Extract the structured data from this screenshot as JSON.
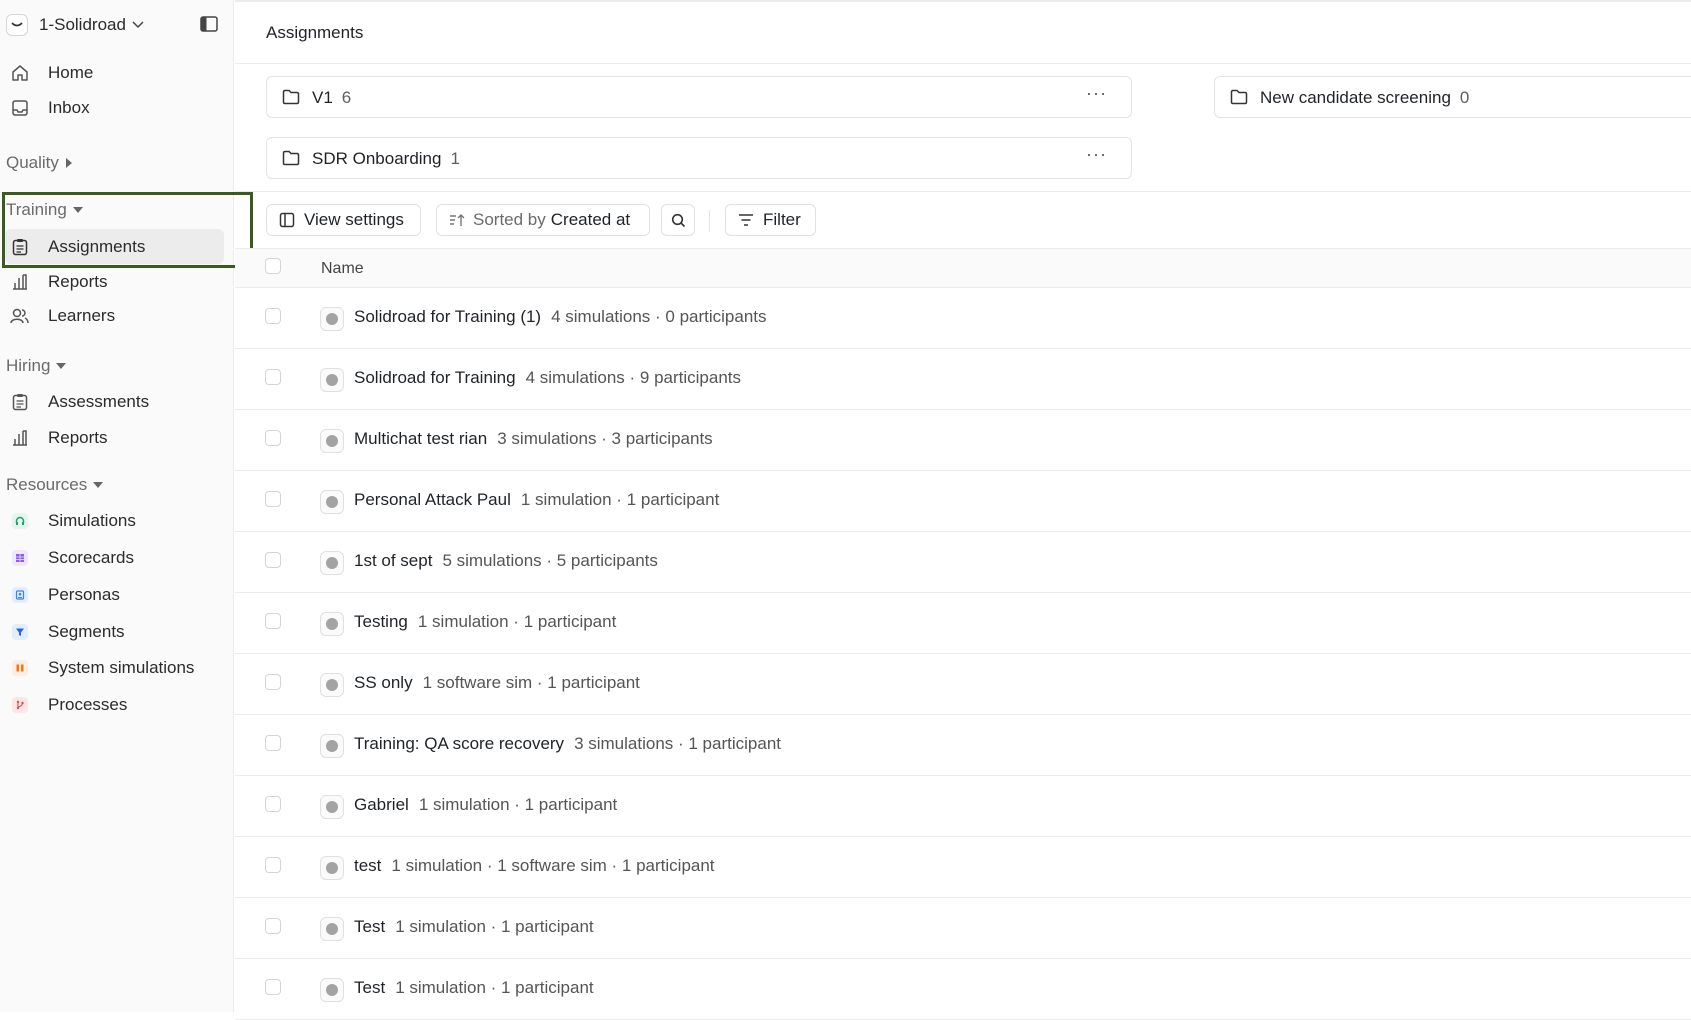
{
  "workspace": {
    "name": "1-Solidroad"
  },
  "nav": {
    "home": "Home",
    "inbox": "Inbox",
    "quality": "Quality",
    "training": {
      "label": "Training",
      "items": [
        {
          "label": "Assignments",
          "icon": "clipboard-icon",
          "active": true
        },
        {
          "label": "Reports",
          "icon": "bar-chart-icon"
        },
        {
          "label": "Learners",
          "icon": "users-icon"
        }
      ]
    },
    "hiring": {
      "label": "Hiring",
      "items": [
        {
          "label": "Assessments",
          "icon": "clipboard-icon"
        },
        {
          "label": "Reports",
          "icon": "bar-chart-icon"
        }
      ]
    },
    "resources": {
      "label": "Resources",
      "items": [
        {
          "label": "Simulations",
          "icon": "headset-icon",
          "color": "#22a06b"
        },
        {
          "label": "Scorecards",
          "icon": "grid-icon",
          "color": "#8b5cf6"
        },
        {
          "label": "Personas",
          "icon": "id-card-icon",
          "color": "#3b82f6"
        },
        {
          "label": "Segments",
          "icon": "funnel-icon",
          "color": "#2563eb"
        },
        {
          "label": "System simulations",
          "icon": "columns-icon",
          "color": "#f97316"
        },
        {
          "label": "Processes",
          "icon": "branch-icon",
          "color": "#ef4444"
        }
      ]
    }
  },
  "page": {
    "title": "Assignments"
  },
  "folders": [
    {
      "name": "V1",
      "count": "6",
      "more": "···"
    },
    {
      "name": "New candidate screening",
      "count": "0"
    },
    {
      "name": "SDR Onboarding",
      "count": "1",
      "more": "···"
    }
  ],
  "toolbar": {
    "view_settings": "View settings",
    "sorted_by_prefix": "Sorted by",
    "sorted_by_value": "Created at",
    "filter": "Filter"
  },
  "table": {
    "column_name": "Name",
    "rows": [
      {
        "name": "Solidroad for Training (1)",
        "meta": "4 simulations · 0 participants"
      },
      {
        "name": "Solidroad for Training",
        "meta": "4 simulations · 9 participants"
      },
      {
        "name": "Multichat test rian",
        "meta": "3 simulations · 3 participants"
      },
      {
        "name": "Personal Attack Paul",
        "meta": "1 simulation · 1 participant"
      },
      {
        "name": "1st of sept",
        "meta": "5 simulations · 5 participants"
      },
      {
        "name": "Testing",
        "meta": "1 simulation · 1 participant"
      },
      {
        "name": "SS only",
        "meta": "1 software sim · 1 participant"
      },
      {
        "name": "Training: QA score recovery",
        "meta": "3 simulations · 1 participant"
      },
      {
        "name": "Gabriel",
        "meta": "1 simulation · 1 participant"
      },
      {
        "name": "test",
        "meta": "1 simulation · 1 software sim · 1 participant"
      },
      {
        "name": "Test",
        "meta": "1 simulation · 1 participant"
      },
      {
        "name": "Test",
        "meta": "1 simulation · 1 participant"
      }
    ]
  }
}
